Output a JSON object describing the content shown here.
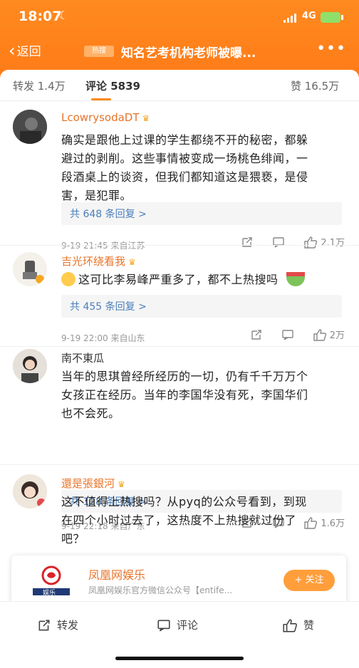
{
  "status_bar": {
    "time": "18:07",
    "network": "4G"
  },
  "nav": {
    "back_label": "返回",
    "hot_tag": "热搜",
    "title": "知名艺考机构老师被曝..."
  },
  "tabs": {
    "repost": "转发 1.4万",
    "comments": "评论 5839",
    "likes": "赞 16.5万"
  },
  "comments": [
    {
      "name": "LcowrysodaDT",
      "lines": [
        "确实是跟他上过课的学生都绕不开的秘密，都躲",
        "避过的剥削。这些事情被变成一场桃色绯闻，一",
        "段酒桌上的谈资，但我们都知道这是猥亵，是侵",
        "害，是犯罪。"
      ],
      "reply_link": "共 648 条回复 >",
      "meta": "9-19 21:45  来自江苏",
      "like_count": "2.1万"
    },
    {
      "name": "吉光环绕看我",
      "lines": [
        "这可比李易峰严重多了，都不上热搜吗"
      ],
      "reply_link": "共 455 条回复 >",
      "meta": "9-19 22:00  来自山东",
      "like_count": "2万"
    },
    {
      "name": "南不東瓜",
      "lines": [
        "当年的思琪曾经所经历的一切，仍有千千万万个",
        "女孩正在经历。当年的李国华没有死，李国华们",
        "也不会死。"
      ],
      "reply_link": "共 128 条回复 >",
      "meta": "9-19 22:18  来自广东",
      "like_count": "1.6万"
    },
    {
      "name": "還是張銀河",
      "lines": [
        "这不值得上热搜吗？从pyq的公众号看到，到现",
        "在四个小时过去了，这热度不上热搜就过份了",
        "吧？"
      ]
    }
  ],
  "follow_card": {
    "logo_text": "娱乐",
    "brand_name": "凤凰网娱乐",
    "description": "凤凰网娱乐官方微信公众号【entife...",
    "follow_label": "+ 关注"
  },
  "bottom_bar": {
    "repost": "转发",
    "comment": "评论",
    "like": "赞"
  },
  "colors": {
    "accent": "#ff7a18",
    "link": "#4a7ebb",
    "username": "#e8742a"
  }
}
